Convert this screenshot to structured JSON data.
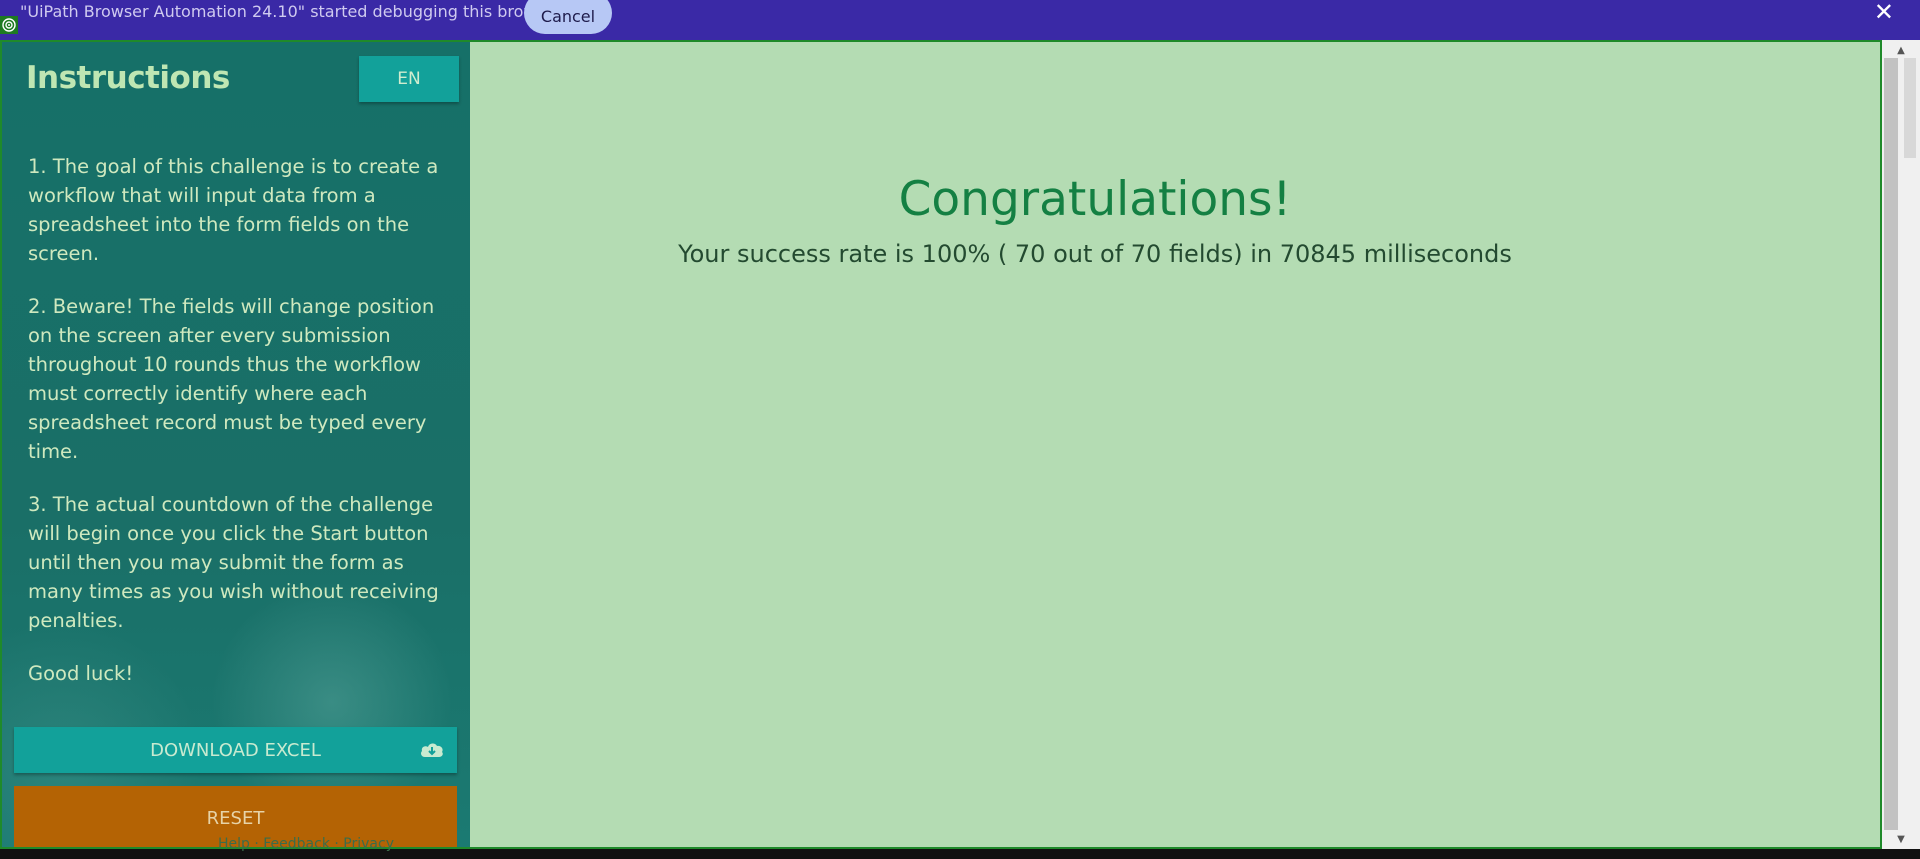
{
  "debug_bar": {
    "message": "\"UiPath Browser Automation 24.10\" started debugging this browser",
    "cancel_label": "Cancel",
    "close_label": "✕"
  },
  "sidebar": {
    "title": "Instructions",
    "lang_label": "EN",
    "paragraphs": [
      "1. The goal of this challenge is to create a workflow that will input data from a spreadsheet into the form fields on the screen.",
      "2. Beware! The fields will change position on the screen after every submission throughout 10 rounds thus the workflow must correctly identify where each spreadsheet record must be typed every time.",
      "3. The actual countdown of the challenge will begin once you click the Start button until then you may submit the form as many times as you wish without receiving penalties.",
      "Good luck!"
    ],
    "download_label": "DOWNLOAD EXCEL",
    "reset_label": "RESET"
  },
  "main": {
    "congrats": "Congratulations!",
    "success_message": "Your success rate is 100% ( 70 out of 70 fields) in 70845 milliseconds"
  },
  "footer": {
    "ghost_text": "Help · Feedback · Privacy"
  },
  "colors": {
    "debug_bar": "#3a29a6",
    "sidebar": "#1a6f67",
    "main_bg": "#b4dcb3",
    "accent_teal": "#12a19a",
    "reset_orange": "#b46304",
    "congrats_green": "#148043"
  },
  "icons": {
    "debug": "uipath-target-icon",
    "download": "cloud-download-icon",
    "close": "close-icon"
  }
}
